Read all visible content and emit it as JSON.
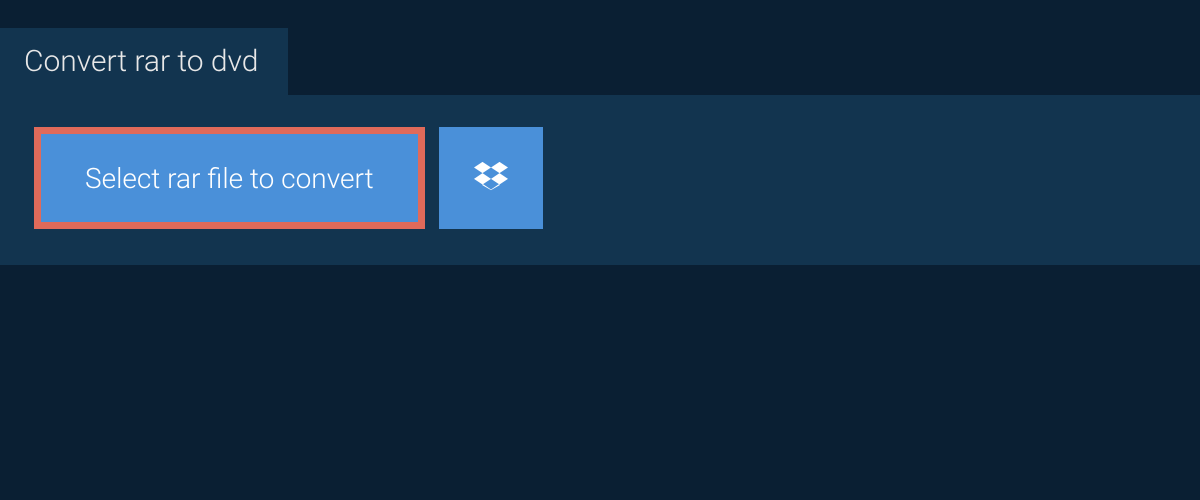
{
  "tab": {
    "label": "Convert rar to dvd"
  },
  "actions": {
    "select_file_label": "Select rar file to convert"
  }
}
